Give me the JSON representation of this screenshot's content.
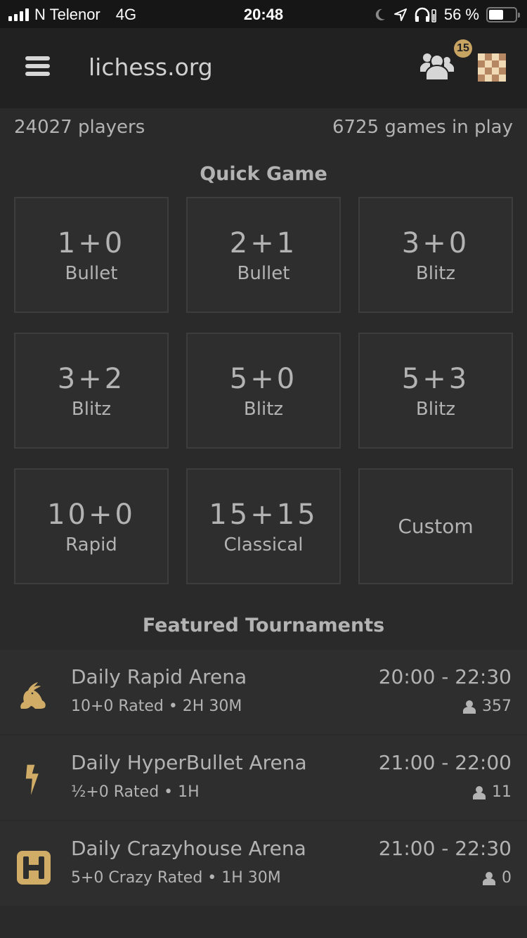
{
  "status_bar": {
    "carrier": "N Telenor",
    "network": "4G",
    "time": "20:48",
    "battery_percent_label": "56 %",
    "battery_level": 0.56
  },
  "header": {
    "title": "lichess.org",
    "friends_count": "15",
    "icons": {
      "menu": "hamburger-icon",
      "friends": "friends-icon",
      "board": "chessboard-icon"
    }
  },
  "stats": {
    "players": "24027 players",
    "games": "6725 games in play"
  },
  "quick_game": {
    "title": "Quick Game",
    "pools": [
      {
        "clock": "1+0",
        "perf": "Bullet"
      },
      {
        "clock": "2+1",
        "perf": "Bullet"
      },
      {
        "clock": "3+0",
        "perf": "Blitz"
      },
      {
        "clock": "3+2",
        "perf": "Blitz"
      },
      {
        "clock": "5+0",
        "perf": "Blitz"
      },
      {
        "clock": "5+3",
        "perf": "Blitz"
      },
      {
        "clock": "10+0",
        "perf": "Rapid"
      },
      {
        "clock": "15+15",
        "perf": "Classical"
      }
    ],
    "custom_label": "Custom"
  },
  "featured_tournaments": {
    "title": "Featured Tournaments",
    "items": [
      {
        "icon": "rabbit-icon",
        "name": "Daily Rapid Arena",
        "info": "10+0 Rated • 2H 30M",
        "time": "20:00 - 22:30",
        "players": "357"
      },
      {
        "icon": "lightning-icon",
        "name": "Daily HyperBullet Arena",
        "info": "½+0 Rated • 1H",
        "time": "21:00 - 22:00",
        "players": "11"
      },
      {
        "icon": "crazyhouse-icon",
        "name": "Daily Crazyhouse Arena",
        "info": "5+0 Crazy Rated • 1H 30M",
        "time": "21:00 - 22:30",
        "players": "0"
      }
    ]
  },
  "colors": {
    "accent_gold": "#c7a462",
    "board_light": "#f0d9b5",
    "board_dark": "#b58863"
  }
}
